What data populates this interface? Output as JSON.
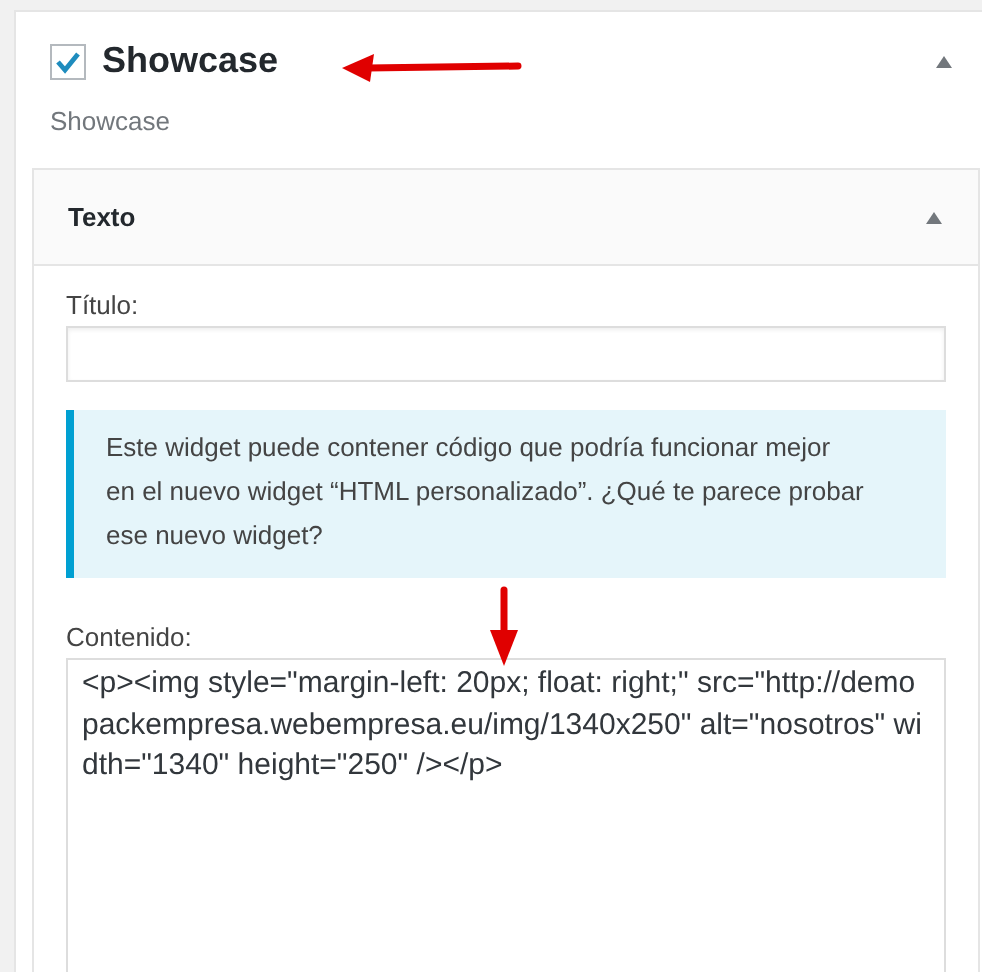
{
  "widget": {
    "title": "Showcase",
    "checked": true,
    "expanded": true,
    "subtitle": "Showcase"
  },
  "inner_widget": {
    "title": "Texto",
    "expanded": true,
    "title_field": {
      "label": "Título:"
    },
    "notice": "Este widget puede contener código que podría funcionar mejor en el nuevo widget “HTML personalizado”. ¿Qué te parece probar ese nuevo widget?",
    "content_field": {
      "label": "Contenido:",
      "value": "<p><img style=\"margin-left: 20px; float: right;\" src=\"http://demopackempresa.webempresa.eu/img/1340x250\" alt=\"nosotros\" width=\"1340\" height=\"250\" /></p>"
    }
  }
}
